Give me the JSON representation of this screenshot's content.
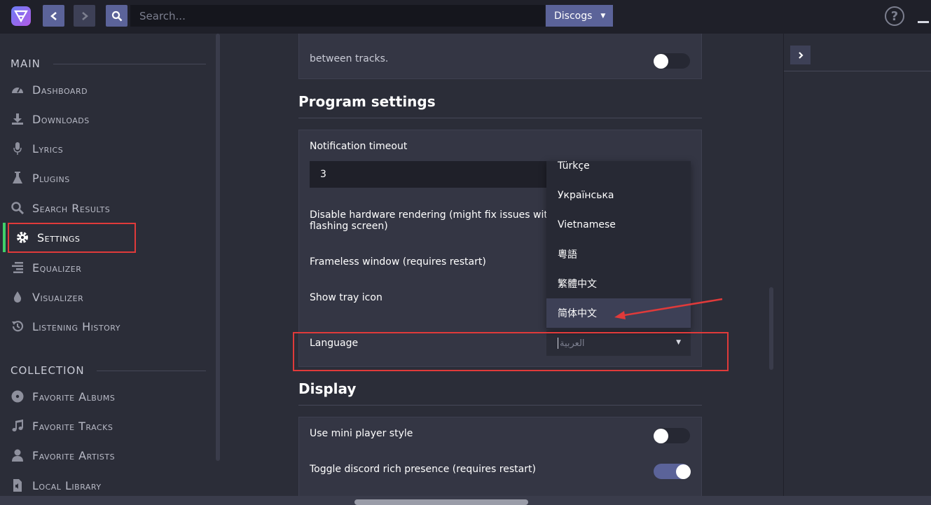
{
  "topbar": {
    "search_placeholder": "Search...",
    "provider": "Discogs",
    "help_symbol": "?"
  },
  "sidebar": {
    "main_title": "MAIN",
    "main_items": [
      {
        "label": "Dashboard",
        "icon": "dashboard-icon"
      },
      {
        "label": "Downloads",
        "icon": "download-icon"
      },
      {
        "label": "Lyrics",
        "icon": "microphone-icon"
      },
      {
        "label": "Plugins",
        "icon": "flask-icon"
      },
      {
        "label": "Search Results",
        "icon": "search-icon"
      },
      {
        "label": "Settings",
        "icon": "gear-icon",
        "active": true
      },
      {
        "label": "Equalizer",
        "icon": "equalizer-icon"
      },
      {
        "label": "Visualizer",
        "icon": "drop-icon"
      },
      {
        "label": "Listening History",
        "icon": "history-icon"
      }
    ],
    "collection_title": "COLLECTION",
    "collection_items": [
      {
        "label": "Favorite Albums",
        "icon": "disc-icon"
      },
      {
        "label": "Favorite Tracks",
        "icon": "music-note-icon"
      },
      {
        "label": "Favorite Artists",
        "icon": "user-icon"
      },
      {
        "label": "Local Library",
        "icon": "file-audio-icon"
      }
    ]
  },
  "settings": {
    "prev_card_text": "between tracks.",
    "program_heading": "Program settings",
    "notification_label": "Notification timeout",
    "notification_value": "3",
    "hw_label_1": "Disable hardware rendering (might fix issues with dra",
    "hw_label_2": "flashing screen)",
    "frameless_label": "Frameless window (requires restart)",
    "tray_label": "Show tray icon",
    "language_label": "Language",
    "language_value": "العربية",
    "language_options": [
      "Türkçe",
      "Українська",
      "Vietnamese",
      "粵語",
      "繁體中文",
      "简体中文"
    ],
    "language_highlighted": "简体中文",
    "display_heading": "Display",
    "mini_player_label": "Use mini player style",
    "discord_label": "Toggle discord rich presence (requires restart)"
  },
  "colors": {
    "accent": "#5b6399",
    "active_indicator": "#3fd16a",
    "annotation": "#e03a3a"
  }
}
